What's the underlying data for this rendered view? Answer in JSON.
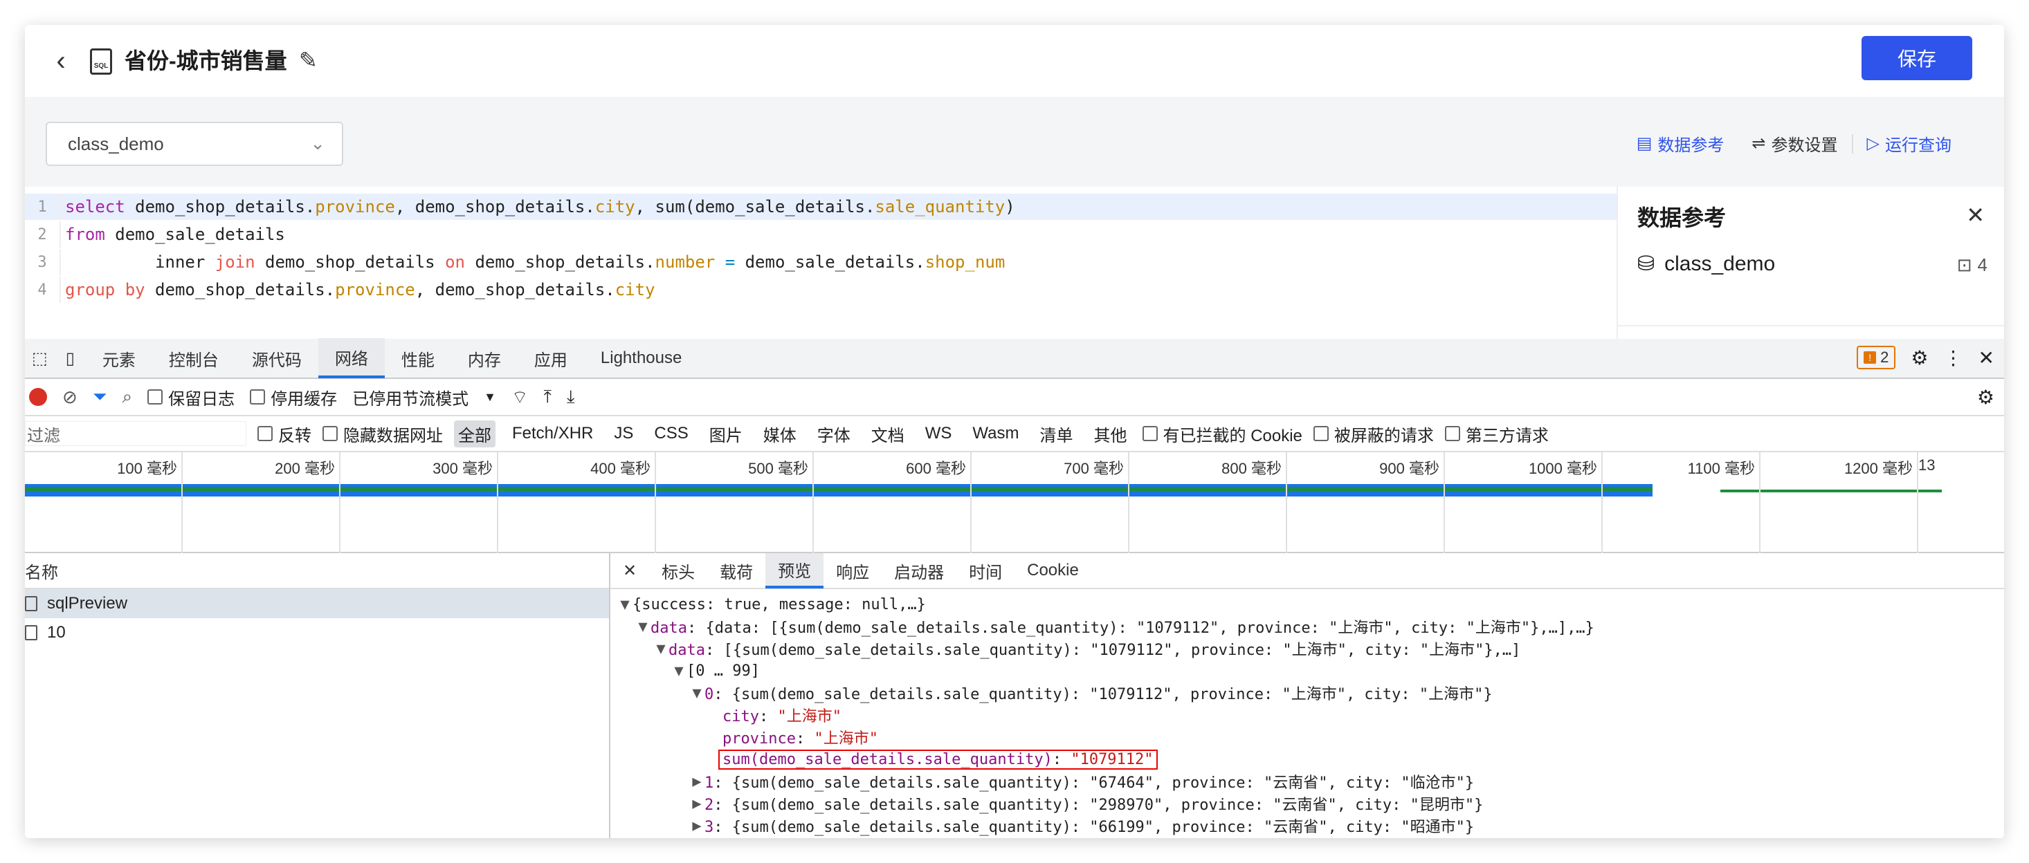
{
  "header": {
    "back_label": "‹",
    "title": "省份-城市销售量",
    "file_icon_text": "SQL",
    "save_label": "保存"
  },
  "toolbar": {
    "database": "class_demo",
    "data_ref_label": "数据参考",
    "params_label": "参数设置",
    "run_label": "运行查询"
  },
  "editor": {
    "lines": [
      {
        "num": "1",
        "parts": [
          {
            "t": "select",
            "c": "kw"
          },
          {
            "t": " demo_shop_details.",
            "c": ""
          },
          {
            "t": "province",
            "c": "pr"
          },
          {
            "t": ", demo_shop_details.",
            "c": ""
          },
          {
            "t": "city",
            "c": "pr"
          },
          {
            "t": ", sum(demo_sale_details.",
            "c": ""
          },
          {
            "t": "sale_quantity",
            "c": "pr"
          },
          {
            "t": ")",
            "c": ""
          }
        ]
      },
      {
        "num": "2",
        "parts": [
          {
            "t": "from",
            "c": "kw"
          },
          {
            "t": " demo_sale_details",
            "c": ""
          }
        ]
      },
      {
        "num": "3",
        "parts": [
          {
            "t": "         inner ",
            "c": ""
          },
          {
            "t": "join",
            "c": "kw2"
          },
          {
            "t": " demo_shop_details ",
            "c": ""
          },
          {
            "t": "on",
            "c": "kw2"
          },
          {
            "t": " demo_shop_details.",
            "c": ""
          },
          {
            "t": "number",
            "c": "pr"
          },
          {
            "t": " ",
            "c": ""
          },
          {
            "t": "=",
            "c": "op"
          },
          {
            "t": " demo_sale_details.",
            "c": ""
          },
          {
            "t": "shop_num",
            "c": "pr"
          }
        ]
      },
      {
        "num": "4",
        "parts": [
          {
            "t": "group by",
            "c": "kw2"
          },
          {
            "t": " demo_shop_details.",
            "c": ""
          },
          {
            "t": "province",
            "c": "pr"
          },
          {
            "t": ", demo_shop_details.",
            "c": ""
          },
          {
            "t": "city",
            "c": "pr"
          }
        ]
      }
    ]
  },
  "reference_panel": {
    "title": "数据参考",
    "close": "✕",
    "database": "class_demo",
    "table_count": "4"
  },
  "devtools": {
    "tabs": [
      "元素",
      "控制台",
      "源代码",
      "网络",
      "性能",
      "内存",
      "应用",
      "Lighthouse"
    ],
    "selected_tab": "网络",
    "issues_count": "2",
    "toolbar": {
      "preserve_log": "保留日志",
      "disable_cache": "停用缓存",
      "throttle": "已停用节流模式"
    },
    "filter": {
      "placeholder": "过滤",
      "invert": "反转",
      "hide_data_urls": "隐藏数据网址",
      "types": [
        "全部",
        "Fetch/XHR",
        "JS",
        "CSS",
        "图片",
        "媒体",
        "字体",
        "文档",
        "WS",
        "Wasm",
        "清单",
        "其他"
      ],
      "blocked_cookies": "有已拦截的 Cookie",
      "blocked_requests": "被屏蔽的请求",
      "third_party": "第三方请求"
    },
    "timeline_ticks": [
      "100 毫秒",
      "200 毫秒",
      "300 毫秒",
      "400 毫秒",
      "500 毫秒",
      "600 毫秒",
      "700 毫秒",
      "800 毫秒",
      "900 毫秒",
      "1000 毫秒",
      "1100 毫秒",
      "1200 毫秒",
      "13"
    ],
    "names_header": "名称",
    "requests": [
      "sqlPreview",
      "10"
    ],
    "detail_tabs": [
      "✕",
      "标头",
      "载荷",
      "预览",
      "响应",
      "启动器",
      "时间",
      "Cookie"
    ],
    "detail_selected": "预览",
    "json_lines": [
      {
        "indent": 0,
        "tri": "▼",
        "text": "{success: true, message: null,…}"
      },
      {
        "indent": 1,
        "tri": "▼",
        "key": "data",
        "text": ": {data: [{sum(demo_sale_details.sale_quantity): \"1079112\", province: \"上海市\", city: \"上海市\"},…],…}"
      },
      {
        "indent": 2,
        "tri": "▼",
        "key": "data",
        "text": ": [{sum(demo_sale_details.sale_quantity): \"1079112\", province: \"上海市\", city: \"上海市\"},…]"
      },
      {
        "indent": 3,
        "tri": "▼",
        "text": "[0 … 99]"
      },
      {
        "indent": 4,
        "tri": "▼",
        "key": "0",
        "text": ": {sum(demo_sale_details.sale_quantity): \"1079112\", province: \"上海市\", city: \"上海市\"}"
      },
      {
        "indent": 5,
        "tri": "",
        "key": "city",
        "text": ": ",
        "str": "\"上海市\""
      },
      {
        "indent": 5,
        "tri": "",
        "key": "province",
        "text": ": ",
        "str": "\"上海市\""
      },
      {
        "indent": 5,
        "tri": "",
        "key": "sum(demo_sale_details.sale_quantity)",
        "text": ": ",
        "str": "\"1079112\"",
        "highlight": true
      },
      {
        "indent": 4,
        "tri": "▶",
        "key": "1",
        "text": ": {sum(demo_sale_details.sale_quantity): \"67464\", province: \"云南省\", city: \"临沧市\"}"
      },
      {
        "indent": 4,
        "tri": "▶",
        "key": "2",
        "text": ": {sum(demo_sale_details.sale_quantity): \"298970\", province: \"云南省\", city: \"昆明市\"}"
      },
      {
        "indent": 4,
        "tri": "▶",
        "key": "3",
        "text": ": {sum(demo_sale_details.sale_quantity): \"66199\", province: \"云南省\", city: \"昭通市\"}"
      }
    ]
  }
}
